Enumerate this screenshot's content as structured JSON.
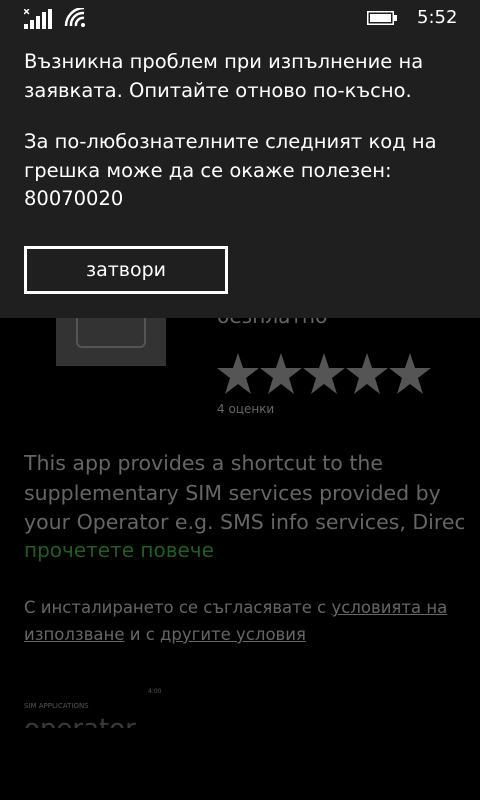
{
  "status_bar": {
    "time": "5:52",
    "icons": [
      "signal-strength-icon",
      "wifi-icon",
      "battery-icon"
    ]
  },
  "app": {
    "price": "безплатно",
    "rating_stars": 5,
    "rating_count": "4 оценки",
    "description_lines": [
      "This app provides a shortcut to the",
      "supplementary SIM services provided by",
      "your Operator e.g. SMS info services, Direct"
    ],
    "read_more": "прочетете повече",
    "terms_prefix": "С инсталирането се съгласявате с ",
    "terms_link1": "условията на използване",
    "terms_middle": " и с ",
    "terms_link2": "другите условия",
    "screenshot_caption": "SIM APPLICATIONS",
    "screenshot_small": "4:00",
    "screenshot_title": "operator"
  },
  "dialog": {
    "message": "Възникна проблем при изпълнение на заявката. Опитайте отново по-късно.",
    "detail": "За по-любознателните следният код на грешка може да се окаже полезен: 80070020",
    "close_label": "затвори"
  },
  "colors": {
    "dialog_bg": "#1f1f1f",
    "page_bg": "#000000",
    "dim_text": "#666666",
    "accent_link": "#1f5f1f"
  }
}
